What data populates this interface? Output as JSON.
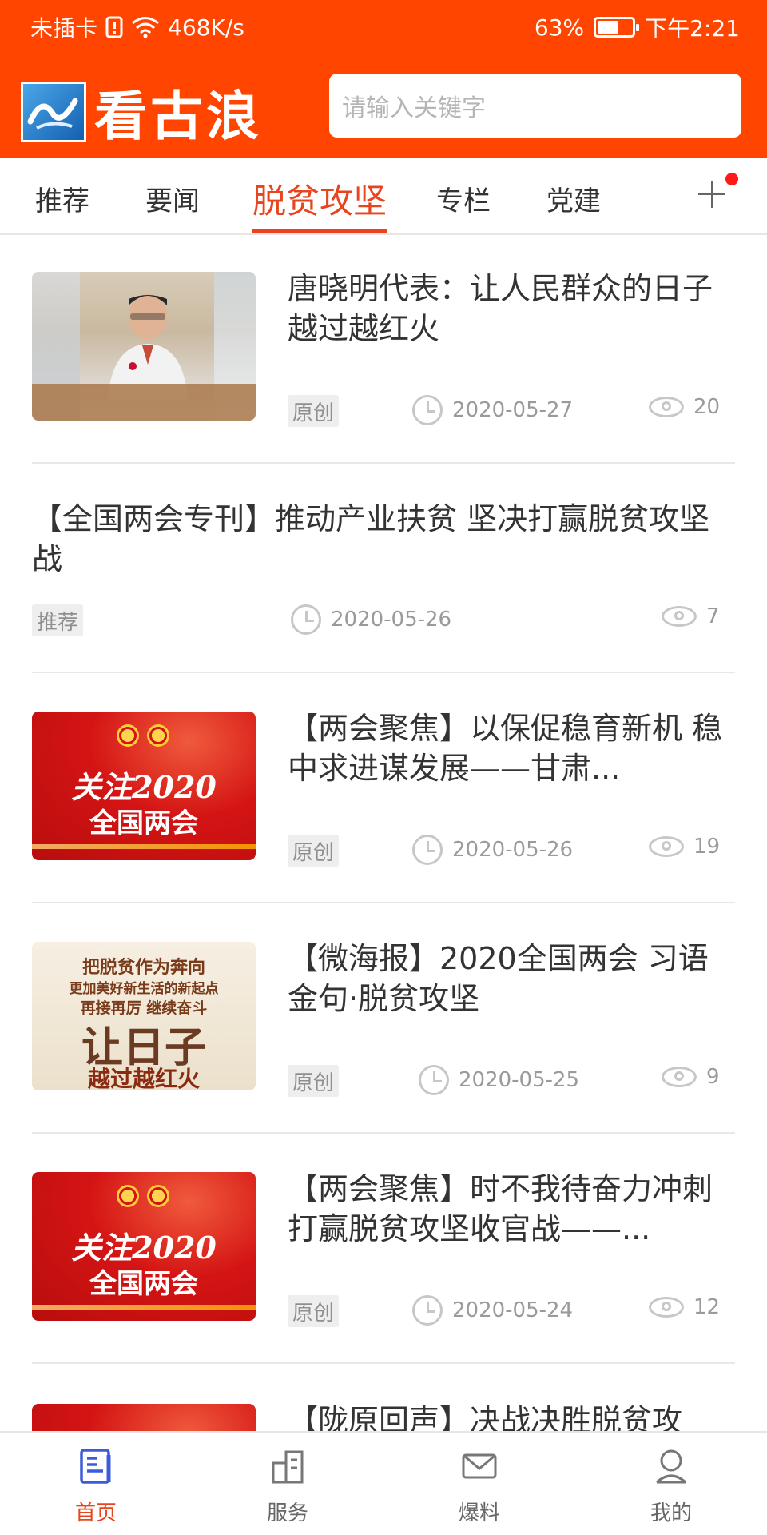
{
  "status_bar": {
    "sim": "未插卡",
    "speed": "468K/s",
    "battery_percent": "63%",
    "battery_level": 0.63,
    "time": "下午2:21"
  },
  "header": {
    "logo_text": "看古浪",
    "search_placeholder": "请输入关键字"
  },
  "tabs": [
    {
      "label": "推荐",
      "active": false
    },
    {
      "label": "要闻",
      "active": false
    },
    {
      "label": "脱贫攻坚",
      "active": true
    },
    {
      "label": "专栏",
      "active": false
    },
    {
      "label": "党建",
      "active": false
    }
  ],
  "news": [
    {
      "title": "唐晓明代表：让人民群众的日子越过越红火",
      "tag": "原创",
      "date": "2020-05-27",
      "views": "20",
      "thumb": "photo"
    },
    {
      "title": "【全国两会专刊】推动产业扶贫 坚决打赢脱贫攻坚战",
      "tag": "推荐",
      "date": "2020-05-26",
      "views": "7",
      "thumb": ""
    },
    {
      "title": "【两会聚焦】以保促稳育新机 稳中求进谋发展——甘肃...",
      "tag": "原创",
      "date": "2020-05-26",
      "views": "19",
      "thumb": "red"
    },
    {
      "title": "【微海报】2020全国两会 习语金句·脱贫攻坚",
      "tag": "原创",
      "date": "2020-05-25",
      "views": "9",
      "thumb": "poster"
    },
    {
      "title": "【两会聚焦】时不我待奋力冲刺 打赢脱贫攻坚收官战——...",
      "tag": "原创",
      "date": "2020-05-24",
      "views": "12",
      "thumb": "red"
    },
    {
      "title": "【陇原回声】决战决胜脱贫攻",
      "tag": "",
      "date": "",
      "views": "",
      "thumb": "red"
    }
  ],
  "thumb_text": {
    "red_line1": "关注2020",
    "red_line2": "全国两会",
    "poster_line1": "把脱贫作为奔向",
    "poster_line2": "更加美好新生活的新起点",
    "poster_line3": "再接再厉  继续奋斗",
    "poster_line4": "让日子",
    "poster_line5": "越过越红火"
  },
  "bottom_nav": [
    {
      "label": "首页",
      "icon": "home-doc-icon",
      "active": true
    },
    {
      "label": "服务",
      "icon": "building-icon",
      "active": false
    },
    {
      "label": "爆料",
      "icon": "mail-icon",
      "active": false
    },
    {
      "label": "我的",
      "icon": "user-icon",
      "active": false
    }
  ],
  "colors": {
    "header_bg": "#ff4500",
    "accent": "#e8451e",
    "notification_dot": "#ff1a1a"
  }
}
